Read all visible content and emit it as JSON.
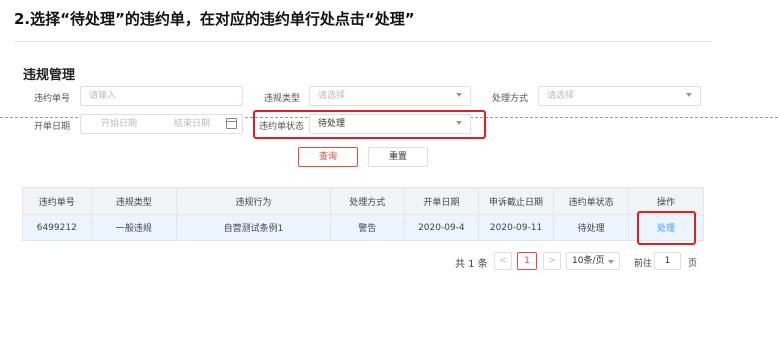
{
  "instruction": "2.选择“待处理”的违约单，在对应的违约单行处点击“处理”",
  "section_title": "违规管理",
  "filters": {
    "violation_no": {
      "label": "违约单号",
      "placeholder": "请输入"
    },
    "violation_type": {
      "label": "违规类型",
      "placeholder": "请选择"
    },
    "handle_method": {
      "label": "处理方式",
      "placeholder": "请选择"
    },
    "open_date": {
      "label": "开单日期",
      "start_placeholder": "开始日期",
      "end_placeholder": "结束日期"
    },
    "status": {
      "label": "违约单状态",
      "value": "待处理"
    }
  },
  "buttons": {
    "query": "查询",
    "reset": "重置"
  },
  "table": {
    "columns": [
      "违约单号",
      "违规类型",
      "违规行为",
      "处理方式",
      "开单日期",
      "申诉截止日期",
      "违约单状态",
      "操作"
    ],
    "rows": [
      {
        "no": "6499212",
        "type": "一般违规",
        "behavior": "自营测试条例1",
        "method": "警告",
        "open_date": "2020-09-4",
        "deadline": "2020-09-11",
        "status": "待处理",
        "action": "处理"
      }
    ]
  },
  "pagination": {
    "total": "共 1 条",
    "prev": "<",
    "current": "1",
    "next": ">",
    "page_size": "10条/页",
    "goto_label": "前往",
    "goto_value": "1",
    "page_unit": "页"
  },
  "colors": {
    "highlight": "#e02020",
    "link": "#409eff",
    "row_bg": "#ecf5ff",
    "header_bg": "#f2f3f5"
  }
}
